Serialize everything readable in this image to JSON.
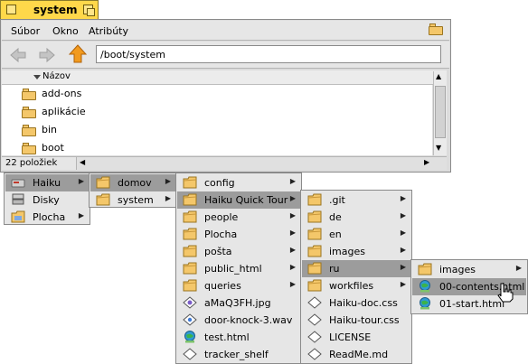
{
  "window": {
    "title": "system"
  },
  "menubar": {
    "items": [
      "Súbor",
      "Okno",
      "Atribúty"
    ]
  },
  "toolbar": {
    "path": "/boot/system"
  },
  "list": {
    "column_header": "Názov",
    "rows": [
      "add-ons",
      "aplikácie",
      "bin",
      "boot"
    ]
  },
  "status": {
    "count": "22 položiek"
  },
  "menus": {
    "root": [
      {
        "label": "Haiku",
        "icon": "disk-icon",
        "has_sub": true,
        "selected": true
      },
      {
        "label": "Disky",
        "icon": "disks-icon",
        "has_sub": false
      },
      {
        "label": "Plocha",
        "icon": "desktop-icon",
        "has_sub": true
      }
    ],
    "haiku": [
      {
        "label": "domov",
        "icon": "folder-icon",
        "has_sub": true,
        "selected": true
      },
      {
        "label": "system",
        "icon": "folder-icon",
        "has_sub": true
      }
    ],
    "domov": [
      {
        "label": "config",
        "icon": "folder-icon",
        "has_sub": true
      },
      {
        "label": "Haiku Quick Tour",
        "icon": "folder-icon",
        "has_sub": true,
        "selected": true
      },
      {
        "label": "people",
        "icon": "folder-icon",
        "has_sub": true
      },
      {
        "label": "Plocha",
        "icon": "folder-icon",
        "has_sub": true
      },
      {
        "label": "pošta",
        "icon": "folder-icon",
        "has_sub": true
      },
      {
        "label": "public_html",
        "icon": "folder-icon",
        "has_sub": true
      },
      {
        "label": "queries",
        "icon": "folder-icon",
        "has_sub": true
      },
      {
        "label": "aMaQ3FH.jpg",
        "icon": "image-file-icon",
        "has_sub": false
      },
      {
        "label": "door-knock-3.wav",
        "icon": "audio-file-icon",
        "has_sub": false
      },
      {
        "label": "test.html",
        "icon": "html-file-icon",
        "has_sub": false
      },
      {
        "label": "tracker_shelf",
        "icon": "file-icon",
        "has_sub": false
      }
    ],
    "tour": [
      {
        "label": ".git",
        "icon": "folder-icon",
        "has_sub": true
      },
      {
        "label": "de",
        "icon": "folder-icon",
        "has_sub": true
      },
      {
        "label": "en",
        "icon": "folder-icon",
        "has_sub": true
      },
      {
        "label": "images",
        "icon": "folder-icon",
        "has_sub": true
      },
      {
        "label": "ru",
        "icon": "folder-icon",
        "has_sub": true,
        "selected": true
      },
      {
        "label": "workfiles",
        "icon": "folder-icon",
        "has_sub": true
      },
      {
        "label": "Haiku-doc.css",
        "icon": "file-icon",
        "has_sub": false
      },
      {
        "label": "Haiku-tour.css",
        "icon": "file-icon",
        "has_sub": false
      },
      {
        "label": "LICENSE",
        "icon": "file-icon",
        "has_sub": false
      },
      {
        "label": "ReadMe.md",
        "icon": "file-icon",
        "has_sub": false
      }
    ],
    "ru": [
      {
        "label": "images",
        "icon": "folder-icon",
        "has_sub": true
      },
      {
        "label": "00-contents.html",
        "icon": "html-file-icon",
        "has_sub": false,
        "selected": true
      },
      {
        "label": "01-start.html",
        "icon": "html-file-icon",
        "has_sub": false
      }
    ]
  }
}
